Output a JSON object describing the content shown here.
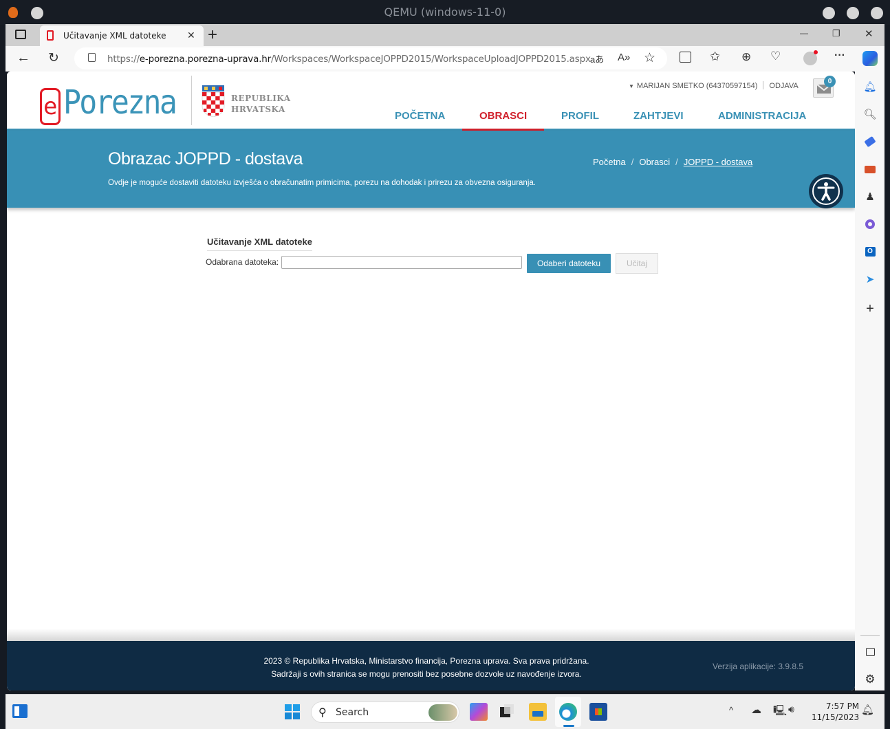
{
  "qemu": {
    "title": "QEMU (windows-11-0)"
  },
  "browser": {
    "tab_title": "Učitavanje XML datoteke",
    "url_scheme": "https://",
    "url_host": "e-porezna.porezna-uprava.hr",
    "url_path": "/Workspaces/WorkspaceJOPPD2015/WorkspaceUploadJOPPD2015.aspx",
    "new_tab_label": "+",
    "window_controls": {
      "minimize": "—",
      "restore": "❐",
      "close": "✕"
    }
  },
  "header": {
    "logo_e": "e",
    "logo_text": "Porezna",
    "republic_line1": "REPUBLIKA",
    "republic_line2": "HRVATSKA",
    "user": "MARIJAN SMETKO (64370597154)",
    "logout": "ODJAVA",
    "mail_count": "0",
    "nav": [
      {
        "label": "POČETNA",
        "active": false
      },
      {
        "label": "OBRASCI",
        "active": true
      },
      {
        "label": "PROFIL",
        "active": false
      },
      {
        "label": "ZAHTJEVI",
        "active": false
      },
      {
        "label": "ADMINISTRACIJA",
        "active": false
      }
    ]
  },
  "banner": {
    "title": "Obrazac JOPPD - dostava",
    "description": "Ovdje je moguće dostaviti datoteku izvješća o obračunatim primicima, porezu na dohodak i prirezu za obvezna osiguranja.",
    "breadcrumb": [
      "Početna",
      "Obrasci",
      "JOPPD - dostava"
    ],
    "breadcrumb_sep": "/"
  },
  "upload": {
    "title": "Učitavanje XML datoteke",
    "file_label": "Odabrana datoteka:",
    "file_value": "",
    "choose_button": "Odaberi datoteku",
    "load_button": "Učitaj"
  },
  "footer": {
    "line1": "2023 © Republika Hrvatska, Ministarstvo financija, Porezna uprava. Sva prava pridržana.",
    "line2": "Sadržaji s ovih stranica se mogu prenositi bez posebne dozvole uz navođenje izvora.",
    "version": "Verzija aplikacije: 3.9.8.5"
  },
  "taskbar": {
    "search_placeholder": "Search",
    "time": "7:57 PM",
    "date": "11/15/2023"
  },
  "colors": {
    "brand_blue": "#3890b5",
    "brand_red": "#d0202b",
    "footer_navy": "#0f2b44"
  }
}
